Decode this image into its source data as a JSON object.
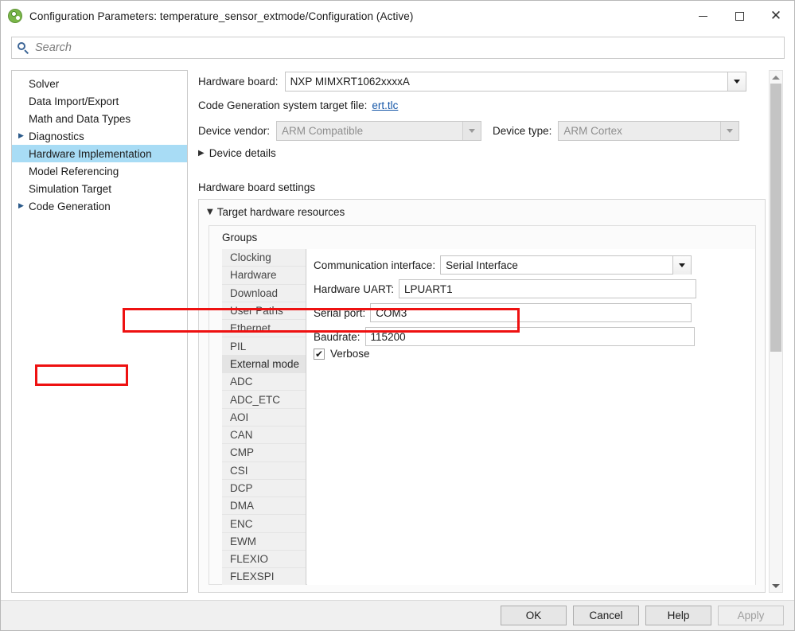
{
  "window": {
    "title": "Configuration Parameters: temperature_sensor_extmode/Configuration (Active)",
    "app_icon": "simulink-logo-icon",
    "controls": {
      "minimize": "minimize-icon",
      "maximize": "maximize-icon",
      "close": "close-icon"
    }
  },
  "search": {
    "icon": "search-icon",
    "placeholder": "Search",
    "value": ""
  },
  "tree": {
    "items": [
      {
        "label": "Solver",
        "expandable": false,
        "selected": false
      },
      {
        "label": "Data Import/Export",
        "expandable": false,
        "selected": false
      },
      {
        "label": "Math and Data Types",
        "expandable": false,
        "selected": false
      },
      {
        "label": "Diagnostics",
        "expandable": true,
        "selected": false
      },
      {
        "label": "Hardware Implementation",
        "expandable": false,
        "selected": true
      },
      {
        "label": "Model Referencing",
        "expandable": false,
        "selected": false
      },
      {
        "label": "Simulation Target",
        "expandable": false,
        "selected": false
      },
      {
        "label": "Code Generation",
        "expandable": true,
        "selected": false
      }
    ],
    "expand_glyph": "▶"
  },
  "main": {
    "hardware_board": {
      "label": "Hardware board:",
      "value": "NXP MIMXRT1062xxxxA",
      "dropdown_icon": "chevron-down-icon"
    },
    "code_generation_target": {
      "label": "Code Generation system target file:",
      "link_text": "ert.tlc"
    },
    "device_vendor": {
      "label": "Device vendor:",
      "value": "ARM Compatible",
      "disabled": true,
      "dropdown_icon": "chevron-down-icon"
    },
    "device_type": {
      "label": "Device type:",
      "value": "ARM Cortex",
      "disabled": true,
      "dropdown_icon": "chevron-down-icon"
    },
    "device_details": {
      "label": "Device details",
      "expanded": false,
      "glyph": "▶"
    },
    "hardware_board_settings_title": "Hardware board settings",
    "target_hardware_resources": {
      "label": "Target hardware resources",
      "expanded": true,
      "glyph": "▼"
    },
    "groups_label": "Groups",
    "groups": [
      {
        "label": "Clocking",
        "selected": false
      },
      {
        "label": "Hardware",
        "selected": false
      },
      {
        "label": "Download",
        "selected": false
      },
      {
        "label": "User Paths",
        "selected": false
      },
      {
        "label": "Ethernet",
        "selected": false
      },
      {
        "label": "PIL",
        "selected": false
      },
      {
        "label": "External mode",
        "selected": true
      },
      {
        "label": "ADC",
        "selected": false
      },
      {
        "label": "ADC_ETC",
        "selected": false
      },
      {
        "label": "AOI",
        "selected": false
      },
      {
        "label": "CAN",
        "selected": false
      },
      {
        "label": "CMP",
        "selected": false
      },
      {
        "label": "CSI",
        "selected": false
      },
      {
        "label": "DCP",
        "selected": false
      },
      {
        "label": "DMA",
        "selected": false
      },
      {
        "label": "ENC",
        "selected": false
      },
      {
        "label": "EWM",
        "selected": false
      },
      {
        "label": "FLEXIO",
        "selected": false
      },
      {
        "label": "FLEXSPI",
        "selected": false
      }
    ],
    "settings": {
      "communication_interface": {
        "label": "Communication interface:",
        "value": "Serial Interface",
        "dropdown_icon": "chevron-down-icon"
      },
      "hardware_uart": {
        "label": "Hardware UART:",
        "value": "LPUART1"
      },
      "serial_port": {
        "label": "Serial port:",
        "value": "COM3",
        "highlighted": true
      },
      "baudrate": {
        "label": "Baudrate:",
        "value": "115200"
      },
      "verbose": {
        "label": "Verbose",
        "checked": true,
        "check_glyph": "✔"
      }
    }
  },
  "scrollbar": {
    "up_icon": "triangle-up-icon",
    "down_icon": "triangle-down-icon"
  },
  "footer": {
    "ok": "OK",
    "cancel": "Cancel",
    "help": "Help",
    "apply": "Apply",
    "apply_disabled": true
  },
  "colors": {
    "highlight_red": "#ee1111",
    "selection_blue": "#a8dcf5",
    "link_blue": "#1657a8",
    "search_icon_blue": "#3c6596"
  }
}
